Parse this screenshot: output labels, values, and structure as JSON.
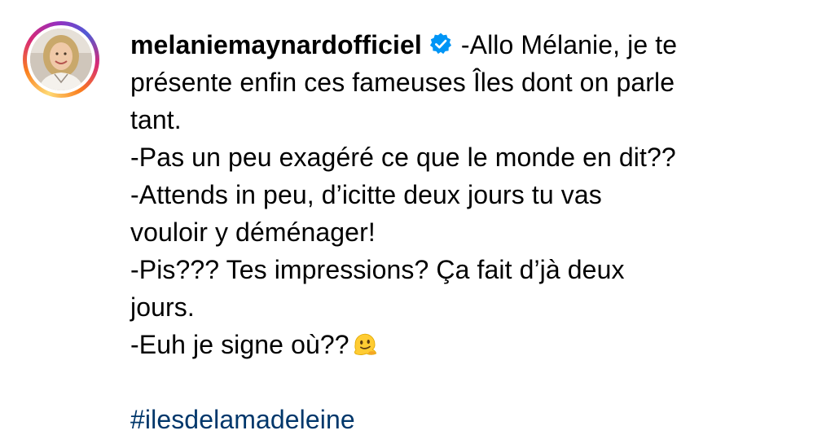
{
  "post": {
    "username": "melaniemaynardofficiel",
    "verified": true,
    "caption_lines": [
      "-Allo Mélanie, je te",
      "présente enfin ces fameuses Îles dont on parle",
      "tant.",
      "-Pas un peu exagéré ce que le monde en dit??",
      "-Attends in peu, d’icitte deux jours tu vas",
      "vouloir y déménager!",
      "-Pis??? Tes impressions? Ça fait d’jà deux",
      "jours.",
      "-Euh je signe où??"
    ],
    "emoji": "melting-face",
    "hashtag": "#ilesdelamadeleine"
  },
  "icons": {
    "verified": "verified-badge-icon",
    "emoji": "melting-face-emoji"
  },
  "colors": {
    "text": "#000000",
    "hashtag": "#00376b",
    "verified_badge": "#0095f6",
    "story_ring_start": "#feda75",
    "story_ring_end": "#d62976"
  }
}
